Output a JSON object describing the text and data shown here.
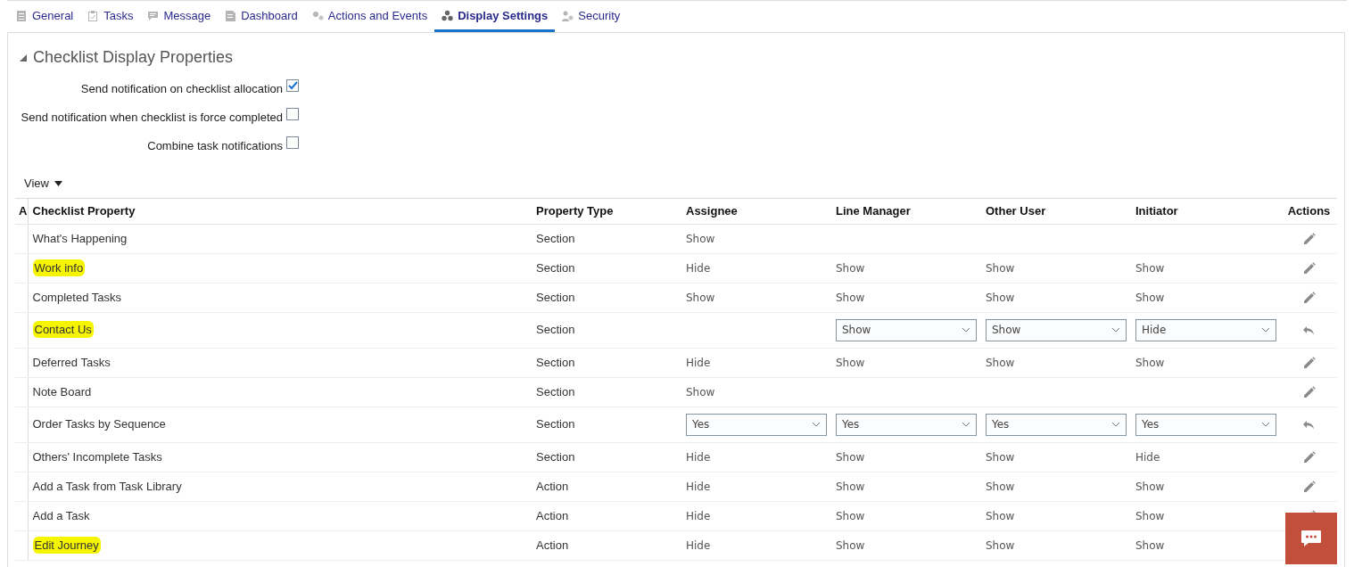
{
  "tabs": [
    {
      "label": "General",
      "selected": false
    },
    {
      "label": "Tasks",
      "selected": false
    },
    {
      "label": "Message",
      "selected": false
    },
    {
      "label": "Dashboard",
      "selected": false
    },
    {
      "label": "Actions and Events",
      "selected": false
    },
    {
      "label": "Display Settings",
      "selected": true
    },
    {
      "label": "Security",
      "selected": false
    }
  ],
  "section": {
    "title": "Checklist Display Properties",
    "expanded": true
  },
  "options": [
    {
      "label": "Send notification on checklist allocation",
      "checked": true
    },
    {
      "label": "Send notification when checklist is force completed",
      "checked": false
    },
    {
      "label": "Combine task notifications",
      "checked": false
    }
  ],
  "view_menu": {
    "label": "View"
  },
  "table": {
    "columns": [
      "A",
      "Checklist Property",
      "Property Type",
      "Assignee",
      "Line Manager",
      "Other User",
      "Initiator",
      "Actions"
    ],
    "rows": [
      {
        "kind": "display",
        "highlighted": false,
        "cells": [
          "",
          "What's Happening",
          "Section",
          "Show",
          "",
          "",
          "",
          ""
        ]
      },
      {
        "kind": "display",
        "highlighted": true,
        "cells": [
          "",
          "Work info",
          "Section",
          "Hide",
          "Show",
          "Show",
          "Show",
          ""
        ]
      },
      {
        "kind": "display",
        "highlighted": false,
        "cells": [
          "",
          "Completed Tasks",
          "Section",
          "Show",
          "Show",
          "Show",
          "Show",
          ""
        ]
      },
      {
        "kind": "editing",
        "highlighted": true,
        "cells": [
          "",
          "Contact Us",
          "Section",
          "",
          "Show",
          "Show",
          "Hide",
          ""
        ]
      },
      {
        "kind": "display",
        "highlighted": false,
        "cells": [
          "",
          "Deferred Tasks",
          "Section",
          "Hide",
          "Show",
          "Show",
          "Show",
          ""
        ]
      },
      {
        "kind": "display",
        "highlighted": false,
        "cells": [
          "",
          "Note Board",
          "Section",
          "Show",
          "",
          "",
          "",
          ""
        ]
      },
      {
        "kind": "editing",
        "highlighted": false,
        "cells": [
          "",
          "Order Tasks by Sequence",
          "Section",
          "Yes",
          "Yes",
          "Yes",
          "Yes",
          ""
        ]
      },
      {
        "kind": "display",
        "highlighted": false,
        "cells": [
          "",
          "Others' Incomplete Tasks",
          "Section",
          "Hide",
          "Show",
          "Show",
          "Hide",
          ""
        ]
      },
      {
        "kind": "display",
        "highlighted": false,
        "cells": [
          "",
          "Add a Task from Task Library",
          "Action",
          "Hide",
          "Show",
          "Show",
          "Show",
          ""
        ]
      },
      {
        "kind": "display",
        "highlighted": false,
        "cells": [
          "",
          "Add a Task",
          "Action",
          "Hide",
          "Show",
          "Show",
          "Show",
          ""
        ]
      },
      {
        "kind": "covered",
        "highlighted": true,
        "cells": [
          "",
          "Edit Journey",
          "Action",
          "Hide",
          "Show",
          "Show",
          "Show",
          ""
        ]
      }
    ]
  }
}
